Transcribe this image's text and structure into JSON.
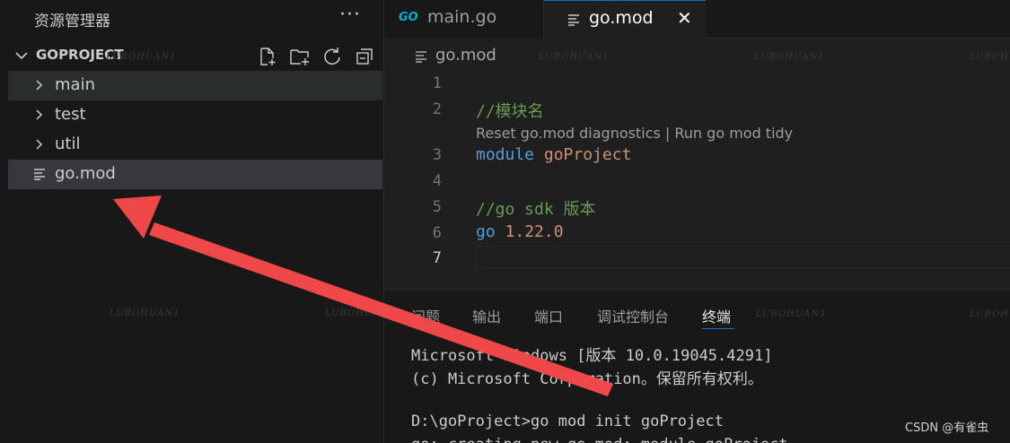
{
  "sidebar": {
    "title": "资源管理器",
    "more_label": "···",
    "project_name": "GOPROJECT",
    "tree": [
      {
        "label": "main",
        "kind": "folder"
      },
      {
        "label": "test",
        "kind": "folder"
      },
      {
        "label": "util",
        "kind": "folder"
      },
      {
        "label": "go.mod",
        "kind": "file"
      }
    ]
  },
  "tabs": [
    {
      "label": "main.go",
      "icon": "go-icon",
      "active": false
    },
    {
      "label": "go.mod",
      "icon": "file-lines-icon",
      "active": true,
      "close": "✕"
    }
  ],
  "tab_go_icon_text": "GO",
  "breadcrumb": {
    "file": "go.mod"
  },
  "editor": {
    "line_numbers": [
      "1",
      "2",
      "3",
      "4",
      "5",
      "6",
      "7"
    ],
    "lines": {
      "l2_comment": "//模块名",
      "codelens": "Reset go.mod diagnostics | Run go mod tidy",
      "l3_keyword": "module",
      "l3_value": "goProject",
      "l5_comment": "//go sdk 版本",
      "l6_keyword": "go",
      "l6_value": "1.22.0"
    },
    "current_line": "7"
  },
  "panel": {
    "tabs": [
      "问题",
      "输出",
      "端口",
      "调试控制台",
      "终端"
    ],
    "active_tab": "终端",
    "terminal": [
      "Microsoft Windows [版本 10.0.19045.4291]",
      "(c) Microsoft Corporation。保留所有权利。",
      "",
      "D:\\goProject>go mod init goProject",
      "go: creating new go.mod: module goProject"
    ]
  },
  "watermark": "LUBOHUAN1",
  "credit": "CSDN @有雀虫",
  "colors": {
    "annotation_arrow": "#f04848",
    "accent": "#0078d4",
    "keyword": "#569cd6",
    "comment": "#6a9955",
    "string": "#ce9178"
  }
}
